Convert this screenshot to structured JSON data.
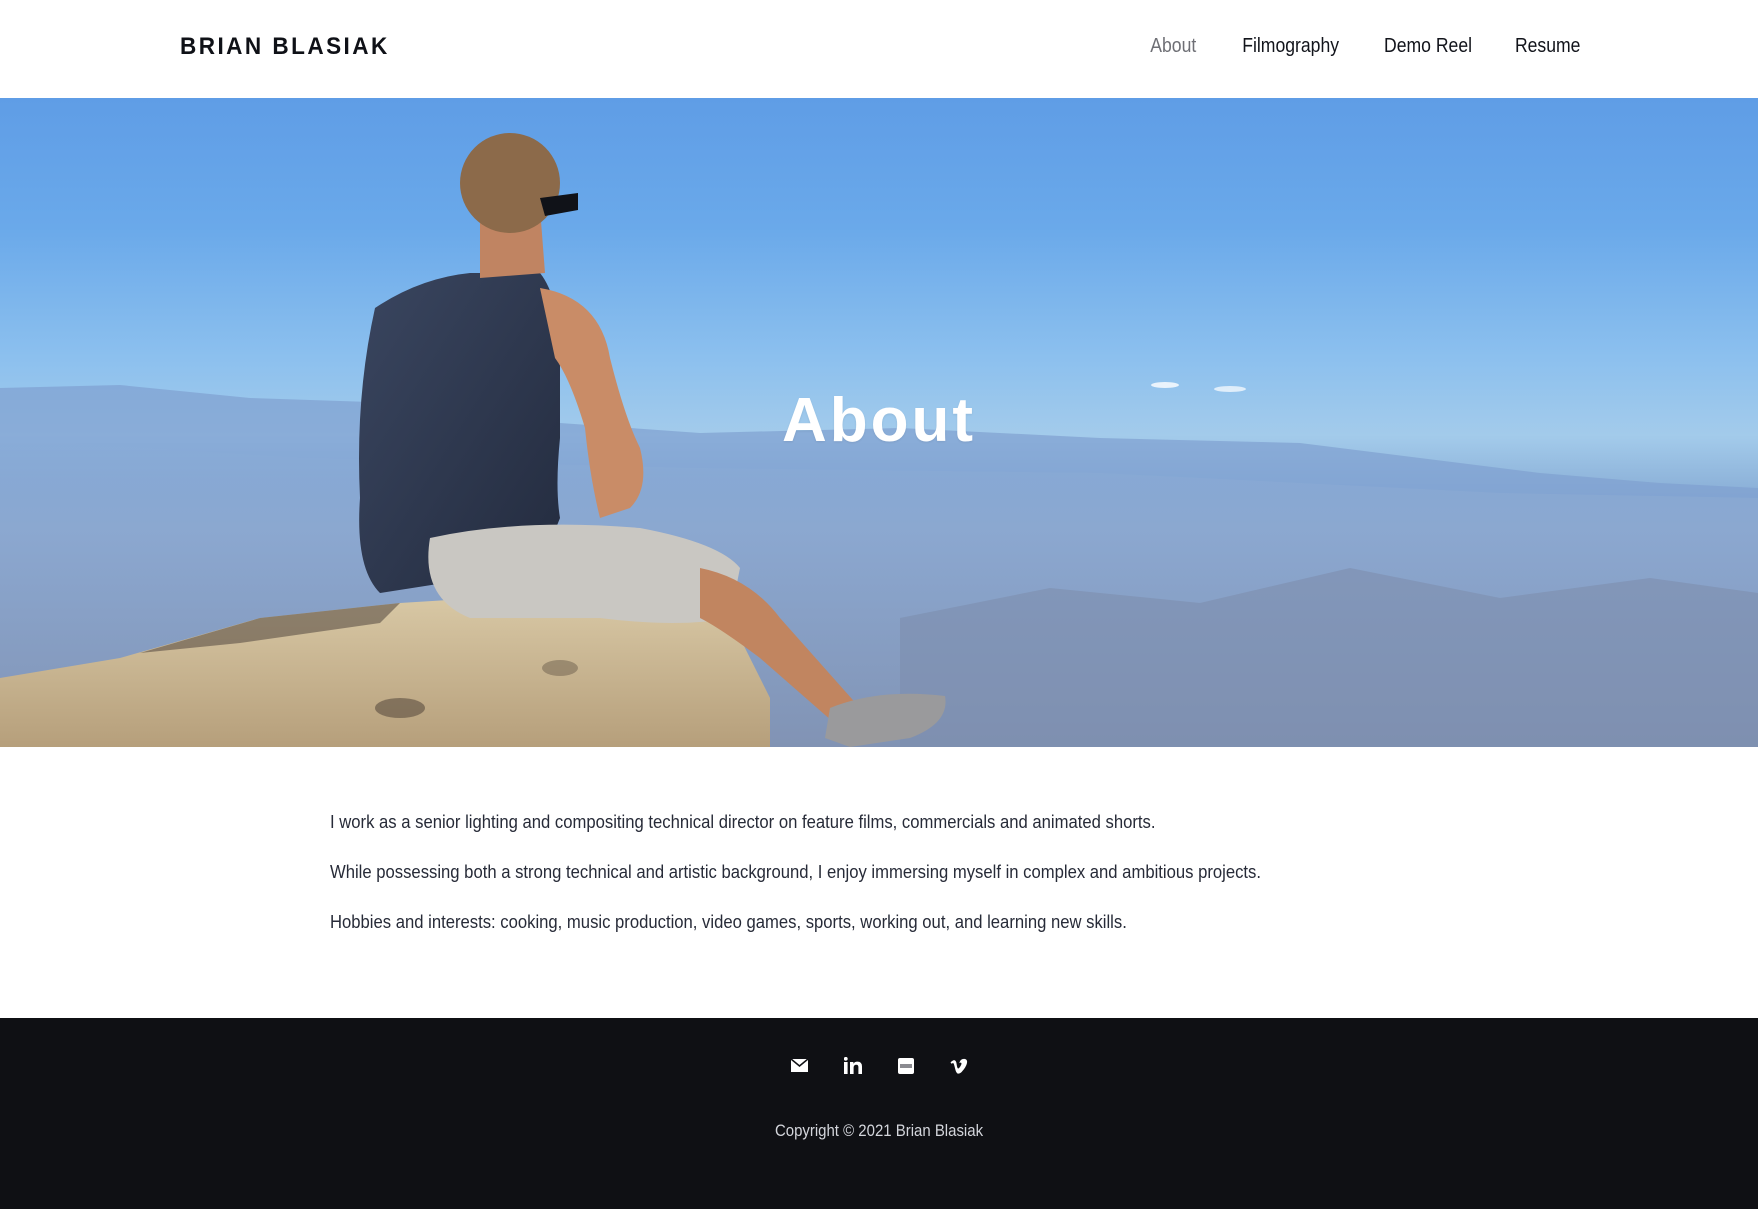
{
  "header": {
    "logo": "BRIAN BLASIAK",
    "nav": [
      {
        "label": "About",
        "active": true
      },
      {
        "label": "Filmography",
        "active": false
      },
      {
        "label": "Demo Reel",
        "active": false
      },
      {
        "label": "Resume",
        "active": false
      }
    ]
  },
  "hero": {
    "title": "About",
    "image_description": "Man in tank top sitting on a rock ledge overlooking a hazy valley under a blue sky"
  },
  "content": {
    "paragraphs": [
      "I work as a senior lighting and compositing technical director on feature films, commercials and animated shorts.",
      "While possessing both a strong technical and artistic background, I enjoy immersing myself in complex and ambitious projects.",
      "Hobbies and interests: cooking, music production, video games, sports, working out, and learning new skills."
    ]
  },
  "footer": {
    "social": [
      {
        "name": "email",
        "icon": "mail-icon"
      },
      {
        "name": "linkedin",
        "icon": "linkedin-icon"
      },
      {
        "name": "imdb",
        "icon": "imdb-icon"
      },
      {
        "name": "vimeo",
        "icon": "vimeo-icon"
      }
    ],
    "copyright": "Copyright © 2021 Brian Blasiak"
  },
  "colors": {
    "footer_bg": "#0f1014",
    "nav_active": "#6e6f75",
    "text": "#272b38",
    "sky": "#6aa9ea"
  }
}
